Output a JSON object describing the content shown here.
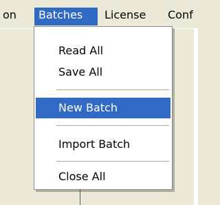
{
  "menubar": {
    "items": [
      {
        "label": "on"
      },
      {
        "label": "Batches"
      },
      {
        "label": "License"
      },
      {
        "label": "Conf"
      }
    ]
  },
  "batches_menu": {
    "items": [
      {
        "label": "Read All"
      },
      {
        "label": "Save All"
      },
      {
        "label": "New Batch"
      },
      {
        "label": "Import Batch"
      },
      {
        "label": "Close All"
      }
    ],
    "highlighted_item": "New Batch"
  },
  "colors": {
    "highlight": "#316ac5",
    "menu_background": "#ffffff",
    "chrome": "#ece9d8"
  }
}
